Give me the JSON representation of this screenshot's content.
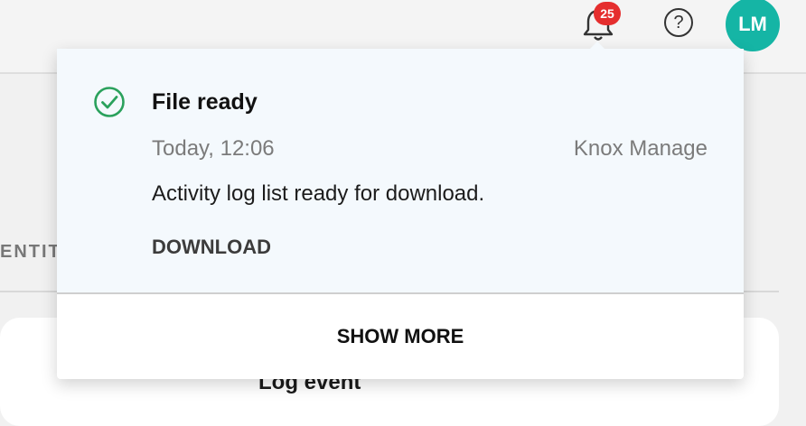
{
  "header": {
    "notifications_badge": "25",
    "help_label": "?",
    "avatar_initials": "LM"
  },
  "background": {
    "tab_fragment": "ENTIT",
    "card_title": "Log event"
  },
  "notification": {
    "title": "File ready",
    "time": "Today, 12:06",
    "source": "Knox Manage",
    "message": "Activity log list ready for download.",
    "action_label": "DOWNLOAD",
    "status_color": "#2aa15c"
  },
  "popup": {
    "show_more_label": "SHOW MORE"
  },
  "colors": {
    "avatar": "#15b5a5",
    "badge": "#e52e2e",
    "notification_bg": "#f4f9fd"
  }
}
